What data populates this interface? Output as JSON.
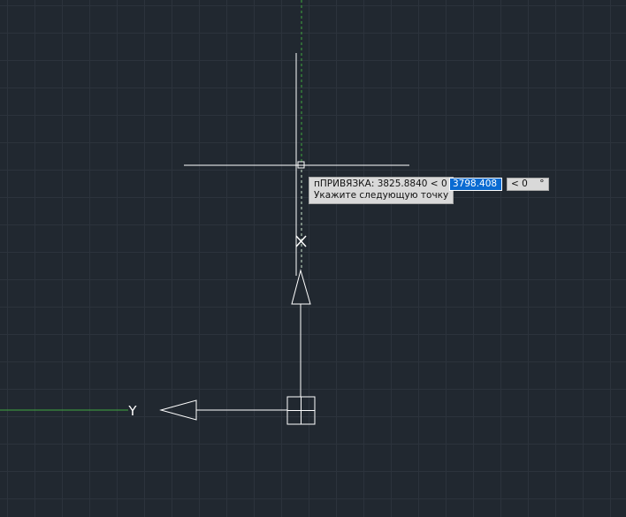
{
  "tooltip": {
    "snap_label": "пПРИВЯЗКА: 3825.8840 < 0",
    "prompt": "Укажите следующую точку"
  },
  "dynamic_input": {
    "distance_value": "3798.408",
    "angle_prefix": "<",
    "angle_value": "0",
    "angle_unit": "°"
  },
  "ucs": {
    "y_axis_label": "Y"
  },
  "colors": {
    "background": "#212830",
    "grid": "#2c333c",
    "crosshair": "#ffffff",
    "tracking_line": "#3fa83f",
    "input_highlight": "#0a6bd2",
    "tooltip_bg": "#d9d9d9"
  }
}
